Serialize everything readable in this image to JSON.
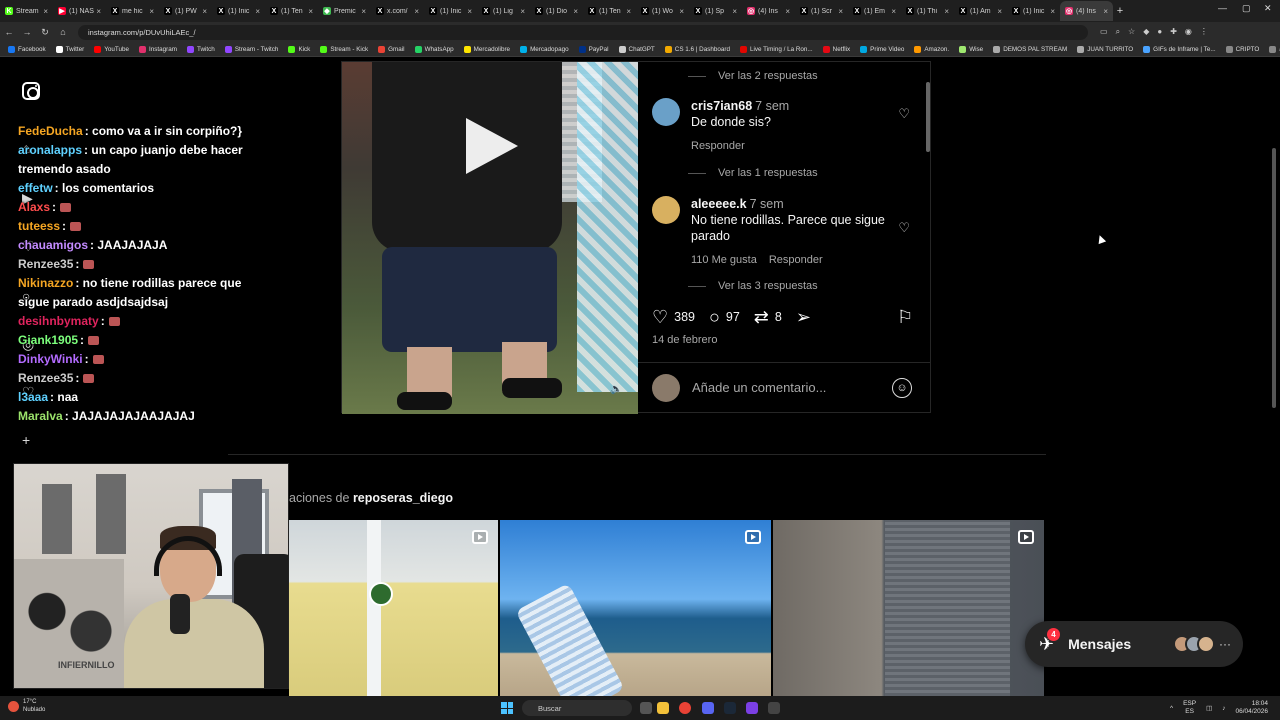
{
  "browser": {
    "tabs": [
      {
        "label": "Stream",
        "color": "#53fc18",
        "glyph": "K"
      },
      {
        "label": "(1) NAS",
        "color": "#ff0033",
        "glyph": "▶"
      },
      {
        "label": "me hic",
        "color": "#ffffff",
        "glyph": "X"
      },
      {
        "label": "(1) PW",
        "color": "#ffffff",
        "glyph": "X"
      },
      {
        "label": "(1) Inic",
        "color": "#ffffff",
        "glyph": "X"
      },
      {
        "label": "(1) Ten",
        "color": "#ffffff",
        "glyph": "X"
      },
      {
        "label": "Premic",
        "color": "#3fb950",
        "glyph": "◆"
      },
      {
        "label": "x.com/",
        "color": "#ffffff",
        "glyph": "X"
      },
      {
        "label": "(1) Inic",
        "color": "#ffffff",
        "glyph": "X"
      },
      {
        "label": "(1) Lig",
        "color": "#ffffff",
        "glyph": "X"
      },
      {
        "label": "(1) Dio",
        "color": "#ffffff",
        "glyph": "X"
      },
      {
        "label": "(1) Ten",
        "color": "#ffffff",
        "glyph": "X"
      },
      {
        "label": "(1) Wo",
        "color": "#ffffff",
        "glyph": "X"
      },
      {
        "label": "(1) Sp",
        "color": "#ffffff",
        "glyph": "X"
      },
      {
        "label": "(4) Ins",
        "color": "#e1306c",
        "glyph": "◎"
      },
      {
        "label": "(1) Scr",
        "color": "#ffffff",
        "glyph": "X"
      },
      {
        "label": "(1) Em",
        "color": "#ffffff",
        "glyph": "X"
      },
      {
        "label": "(1) Thi",
        "color": "#ffffff",
        "glyph": "X"
      },
      {
        "label": "(1) Am",
        "color": "#ffffff",
        "glyph": "X"
      },
      {
        "label": "(1) Inic",
        "color": "#ffffff",
        "glyph": "X"
      },
      {
        "label": "(4) Ins",
        "color": "#e1306c",
        "glyph": "◎",
        "active": true
      }
    ],
    "url": "instagram.com/p/DUvUhiLAEc_/",
    "bookmarks": [
      {
        "label": "Facebook",
        "color": "#1877f2"
      },
      {
        "label": "Twitter",
        "color": "#ffffff"
      },
      {
        "label": "YouTube",
        "color": "#ff0000"
      },
      {
        "label": "Instagram",
        "color": "#e1306c"
      },
      {
        "label": "Twitch",
        "color": "#9146ff"
      },
      {
        "label": "Stream - Twitch",
        "color": "#9146ff"
      },
      {
        "label": "Kick",
        "color": "#53fc18"
      },
      {
        "label": "Stream - Kick",
        "color": "#53fc18"
      },
      {
        "label": "Gmail",
        "color": "#ea4335"
      },
      {
        "label": "WhatsApp",
        "color": "#25d366"
      },
      {
        "label": "Mercadolibre",
        "color": "#ffe600"
      },
      {
        "label": "Mercadopago",
        "color": "#00b1ea"
      },
      {
        "label": "PayPal",
        "color": "#003087"
      },
      {
        "label": "ChatGPT",
        "color": "#cccccc"
      },
      {
        "label": "CS 1.6 | Dashboard",
        "color": "#f2a900"
      },
      {
        "label": "Live Timing / La Ron...",
        "color": "#e10600"
      },
      {
        "label": "Netflix",
        "color": "#e50914"
      },
      {
        "label": "Prime Video",
        "color": "#00a8e1"
      },
      {
        "label": "Amazon.",
        "color": "#ff9900"
      },
      {
        "label": "Wise",
        "color": "#9fe870"
      },
      {
        "label": "DEMOS PAL STREAM",
        "color": "#aaaaaa"
      },
      {
        "label": "JUAN TURRITO",
        "color": "#aaaaaa"
      },
      {
        "label": "GIFs de Inframe | Te...",
        "color": "#4aa3ff"
      },
      {
        "label": "CRIPTO",
        "color": "#888888"
      },
      {
        "label": "aires",
        "color": "#888888"
      }
    ]
  },
  "chat": [
    {
      "user": "FedeDucha",
      "color": "#f5a623",
      "text": ": como va a ir sin corpiño?}"
    },
    {
      "user": "aronalapps",
      "color": "#5fd1ff",
      "text": ": un capo juanjo debe hacer tremendo asado"
    },
    {
      "user": "effetw",
      "color": "#5fd1ff",
      "text": ": los comentarios"
    },
    {
      "user": "Alaxs",
      "color": "#ff4d4d",
      "text": ":",
      "emote": true
    },
    {
      "user": "tuteess",
      "color": "#f5a623",
      "text": ":",
      "emote": true
    },
    {
      "user": "chauamigos",
      "color": "#c38bff",
      "text": ": JAAJAJAJA"
    },
    {
      "user": "Renzee35",
      "color": "#cccccc",
      "text": ":",
      "emote": true
    },
    {
      "user": "Nikinazzo",
      "color": "#f5a623",
      "text": ": no tiene rodillas parece que sigue parado asdjdsajdsaj"
    },
    {
      "user": "desihnbymaty",
      "color": "#e0245e",
      "text": ":",
      "emote": true
    },
    {
      "user": "Giank1905",
      "color": "#7cff7c",
      "text": ":",
      "emote": true
    },
    {
      "user": "DinkyWinki",
      "color": "#b36bff",
      "text": ":",
      "emote": true
    },
    {
      "user": "Renzee35",
      "color": "#cccccc",
      "text": ":",
      "emote": true
    },
    {
      "user": "l3aaa",
      "color": "#5fd1ff",
      "text": ": naa"
    },
    {
      "user": "Maralva",
      "color": "#9be36b",
      "text": ": JAJAJAJAJAAJAJAJ"
    }
  ],
  "post": {
    "replies_top": "Ver las 2 respuestas",
    "comments": [
      {
        "user": "cris7ian68",
        "time": "7 sem",
        "text": "De donde sis?",
        "reply": "Responder",
        "likes": "",
        "avatar": "#6aa0c8"
      },
      {
        "user": "aleeeee.k",
        "time": "7 sem",
        "text": "No tiene rodillas. Parece que sigue parado",
        "reply": "Responder",
        "likes": "110 Me gusta",
        "avatar": "#d8b060"
      }
    ],
    "replies_mid": "Ver las 1 respuestas",
    "replies_bottom": "Ver las 3 respuestas",
    "like_count": "389",
    "comment_count": "97",
    "repost_count": "8",
    "date": "14 de febrero",
    "add_comment_placeholder": "Añade un comentario..."
  },
  "more": {
    "prefix": "aciones de ",
    "account": "reposeras_diego"
  },
  "messages": {
    "label": "Mensajes",
    "badge": "4"
  },
  "webcam": {
    "overlay_text": "INFIERNILLO"
  },
  "taskbar": {
    "temp": "17°C",
    "weather": "Nublado",
    "search": "Buscar",
    "lang": "ESP",
    "lang2": "ES",
    "time": "18:04",
    "date": "06/04/2026"
  }
}
